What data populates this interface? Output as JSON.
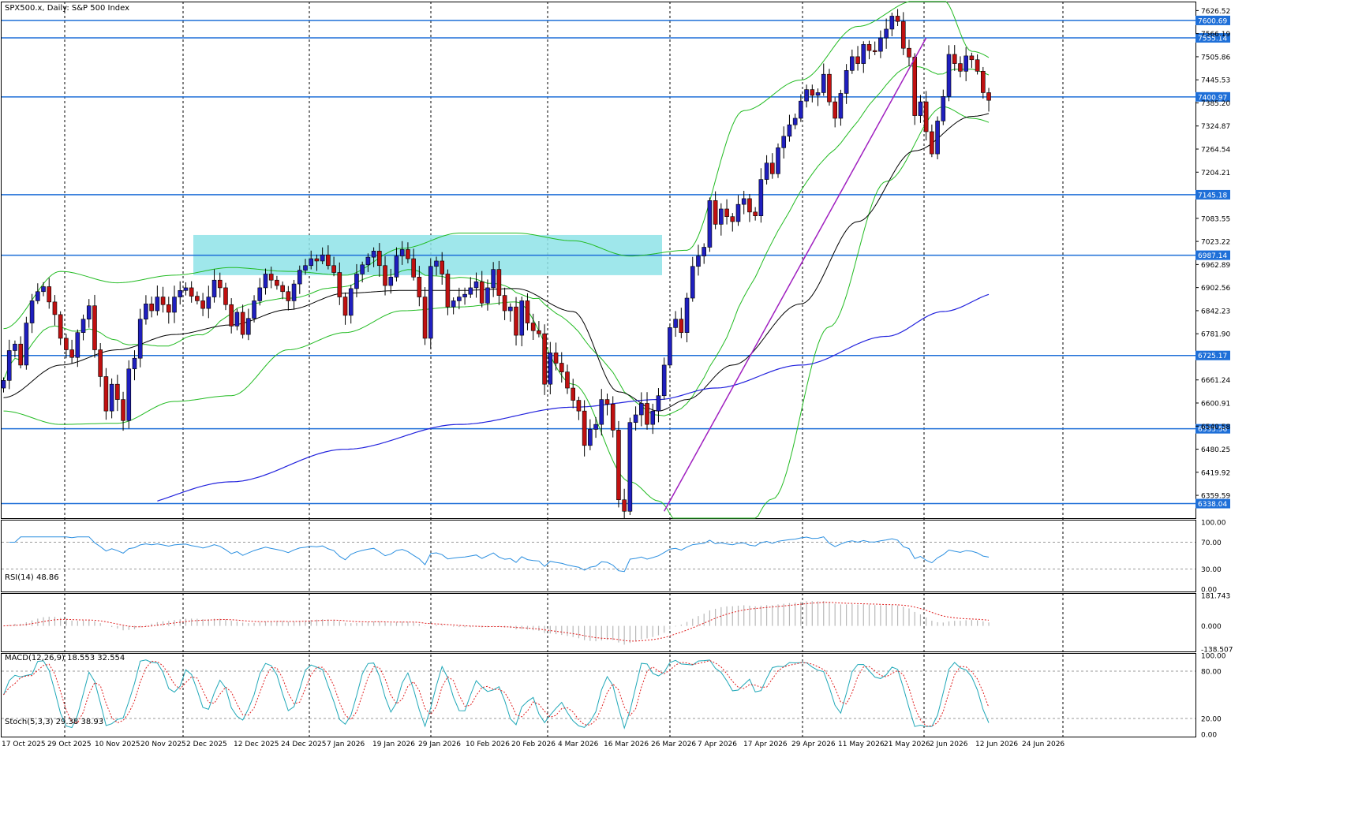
{
  "title": "SPX500.x, Daily:  S&P 500 Index",
  "colors": {
    "background": "#ffffff",
    "bull": "#1f1fbf",
    "bear": "#c01010",
    "level": "#1e6fd8",
    "bollinger": "#22bb22",
    "ma_black": "#000000",
    "ma_blue": "#2222dd",
    "trendline": "#a020c0",
    "zone": "#8ee3e8",
    "rsi": "#2b8fe0",
    "macd_hist": "#b8b8b8",
    "macd_signal": "#e02020",
    "stoch_main": "#20a8b8",
    "stoch_signal": "#e02020",
    "label_bg": "#1e6fd8",
    "grid": "#000000"
  },
  "chart_data": {
    "type": "candlestick",
    "symbol": "SPX500.x",
    "timeframe": "Daily",
    "ylim": [
      6300,
      7650
    ],
    "price_ticks": [
      "7626.52",
      "7566.19",
      "7505.86",
      "7445.53",
      "7385.20",
      "7324.87",
      "7264.54",
      "7204.21",
      "7083.55",
      "7023.22",
      "6962.89",
      "6902.56",
      "6842.23",
      "6781.90",
      "6661.24",
      "6600.91",
      "6540.58",
      "6480.25",
      "6419.92",
      "6359.59"
    ],
    "x_labels": [
      "17 Oct 2025",
      "29 Oct 2025",
      "10 Nov 2025",
      "20 Nov 2025",
      "2 Dec 2025",
      "12 Dec 2025",
      "24 Dec 2025",
      "7 Jan 2026",
      "19 Jan 2026",
      "29 Jan 2026",
      "10 Feb 2026",
      "20 Feb 2026",
      "4 Mar 2026",
      "16 Mar 2026",
      "26 Mar 2026",
      "7 Apr 2026",
      "17 Apr 2026",
      "29 Apr 2026",
      "11 May 2026",
      "21 May 2026",
      "2 Jun 2026",
      "12 Jun 2026",
      "24 Jun 2026"
    ],
    "levels": [
      {
        "value": 7600.69,
        "label": "7600.69"
      },
      {
        "value": 7555.14,
        "label": "7555.14"
      },
      {
        "value": 7400.97,
        "label": "7400.97"
      },
      {
        "value": 7145.18,
        "label": "7145.18"
      },
      {
        "value": 6987.14,
        "label": "6987.14"
      },
      {
        "value": 6725.17,
        "label": "6725.17"
      },
      {
        "value": 6533.56,
        "label": "6533.56"
      },
      {
        "value": 6338.04,
        "label": "6338.04"
      }
    ],
    "zone": {
      "from_index": 33,
      "to_index": 112,
      "low": 6935,
      "high": 7040
    },
    "trendlines": [
      {
        "i1": 116,
        "p1": 6318,
        "i2": 162,
        "p2": 7555
      }
    ],
    "closes": [
      6660,
      6738,
      6755,
      6700,
      6810,
      6868,
      6892,
      6905,
      6865,
      6832,
      6770,
      6740,
      6720,
      6785,
      6820,
      6855,
      6740,
      6670,
      6580,
      6650,
      6610,
      6555,
      6690,
      6718,
      6820,
      6860,
      6842,
      6878,
      6858,
      6838,
      6878,
      6895,
      6902,
      6880,
      6868,
      6848,
      6878,
      6922,
      6902,
      6858,
      6802,
      6838,
      6780,
      6822,
      6868,
      6902,
      6938,
      6922,
      6908,
      6892,
      6868,
      6912,
      6948,
      6960,
      6978,
      6972,
      6988,
      6960,
      6942,
      6878,
      6830,
      6900,
      6938,
      6962,
      6982,
      6998,
      6960,
      6908,
      6930,
      6985,
      7002,
      6978,
      6930,
      6878,
      6770,
      6958,
      6972,
      6938,
      6852,
      6868,
      6878,
      6885,
      6902,
      6918,
      6862,
      6902,
      6950,
      6882,
      6842,
      6852,
      6778,
      6868,
      6810,
      6790,
      6782,
      6650,
      6732,
      6705,
      6682,
      6640,
      6608,
      6580,
      6490,
      6532,
      6545,
      6610,
      6598,
      6530,
      6348,
      6318,
      6550,
      6570,
      6600,
      6545,
      6580,
      6620,
      6700,
      6798,
      6820,
      6785,
      6875,
      6958,
      6985,
      7008,
      7130,
      7068,
      7108,
      7088,
      7075,
      7120,
      7135,
      7100,
      7090,
      7185,
      7228,
      7200,
      7268,
      7298,
      7328,
      7345,
      7390,
      7420,
      7405,
      7412,
      7460,
      7388,
      7345,
      7410,
      7470,
      7506,
      7488,
      7538,
      7522,
      7520,
      7555,
      7578,
      7612,
      7598,
      7528,
      7505,
      7352,
      7388,
      7310,
      7252,
      7338,
      7402,
      7512,
      7488,
      7468,
      7508,
      7498,
      7468,
      7412,
      7392
    ],
    "bollinger_upper_samples": [
      [
        0,
        6795
      ],
      [
        10,
        6945
      ],
      [
        20,
        6915
      ],
      [
        30,
        6935
      ],
      [
        40,
        6955
      ],
      [
        50,
        6945
      ],
      [
        60,
        6935
      ],
      [
        70,
        7005
      ],
      [
        80,
        7045
      ],
      [
        90,
        7045
      ],
      [
        100,
        7025
      ],
      [
        110,
        6985
      ],
      [
        120,
        7000
      ],
      [
        130,
        7365
      ],
      [
        140,
        7445
      ],
      [
        150,
        7585
      ],
      [
        160,
        7652
      ],
      [
        165,
        7655
      ],
      [
        170,
        7520
      ],
      [
        180,
        7445
      ]
    ],
    "bollinger_lower_samples": [
      [
        0,
        6580
      ],
      [
        10,
        6545
      ],
      [
        20,
        6548
      ],
      [
        30,
        6605
      ],
      [
        40,
        6620
      ],
      [
        50,
        6740
      ],
      [
        60,
        6785
      ],
      [
        70,
        6842
      ],
      [
        80,
        6852
      ],
      [
        90,
        6865
      ],
      [
        100,
        6650
      ],
      [
        110,
        6395
      ],
      [
        115,
        6345
      ],
      [
        120,
        6250
      ],
      [
        128,
        6200
      ],
      [
        135,
        6350
      ],
      [
        145,
        6800
      ],
      [
        155,
        7180
      ],
      [
        165,
        7375
      ],
      [
        170,
        7345
      ],
      [
        180,
        7295
      ]
    ],
    "ma_black_samples": [
      [
        0,
        6615
      ],
      [
        10,
        6700
      ],
      [
        20,
        6740
      ],
      [
        30,
        6780
      ],
      [
        40,
        6805
      ],
      [
        50,
        6845
      ],
      [
        60,
        6888
      ],
      [
        70,
        6895
      ],
      [
        80,
        6895
      ],
      [
        90,
        6900
      ],
      [
        100,
        6840
      ],
      [
        108,
        6630
      ],
      [
        115,
        6580
      ],
      [
        120,
        6610
      ],
      [
        128,
        6700
      ],
      [
        140,
        6860
      ],
      [
        150,
        7075
      ],
      [
        160,
        7260
      ],
      [
        170,
        7350
      ],
      [
        180,
        7385
      ]
    ],
    "ma_blue_samples": [
      [
        0,
        6240
      ],
      [
        20,
        6325
      ],
      [
        40,
        6395
      ],
      [
        60,
        6480
      ],
      [
        80,
        6545
      ],
      [
        100,
        6590
      ],
      [
        115,
        6610
      ],
      [
        125,
        6640
      ],
      [
        140,
        6700
      ],
      [
        155,
        6775
      ],
      [
        165,
        6840
      ],
      [
        175,
        6890
      ],
      [
        180,
        6915
      ]
    ],
    "indicators": {
      "rsi": {
        "label": "RSI(14) 48.86",
        "ylim": [
          0,
          100
        ],
        "ticks": [
          "100.00",
          "70.00",
          "30.00",
          "0.00"
        ],
        "levels": [
          30,
          70
        ]
      },
      "macd": {
        "label": "MACD(12,26,9) 18.553 32.554",
        "ylim": [
          -138.507,
          181.743
        ],
        "ticks": [
          "181.743",
          "0.000",
          "-138.507"
        ]
      },
      "stoch": {
        "label": "Stoch(5,3,3) 29.38 38.93",
        "ylim": [
          0,
          100
        ],
        "ticks": [
          "100.00",
          "80.00",
          "20.00",
          "0.00"
        ],
        "levels": [
          20,
          80
        ]
      }
    }
  }
}
